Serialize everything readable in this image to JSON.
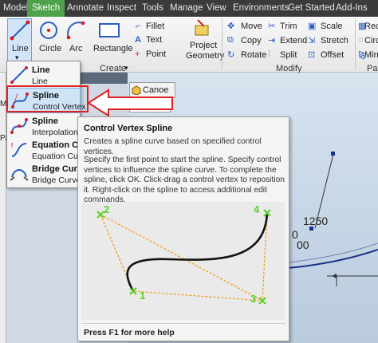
{
  "ribbon_tabs": [
    "Model",
    "Sketch",
    "Annotate",
    "Inspect",
    "Tools",
    "Manage",
    "View",
    "Environments",
    "Get Started",
    "Add-Ins"
  ],
  "active_tab": "Sketch",
  "create_panel": {
    "title": "Create",
    "line": "Line",
    "circle": "Circle",
    "arc": "Arc",
    "rectangle": "Rectangle",
    "fillet": "Fillet",
    "text": "Text",
    "point": "Point",
    "project_geometry_1": "Project",
    "project_geometry_2": "Geometry"
  },
  "modify_panel": {
    "title": "Modify",
    "move": "Move",
    "copy": "Copy",
    "rotate": "Rotate",
    "trim": "Trim",
    "extend": "Extend",
    "split": "Split",
    "scale": "Scale",
    "stretch": "Stretch",
    "offset": "Offset"
  },
  "pattern_panel": {
    "title": "Patt",
    "rect": "Recti",
    "circ": "Circ",
    "mirror": "Mirro"
  },
  "browser": {
    "label_ma": "Ma",
    "label_pa": "Pa"
  },
  "document_tab": "Canoe",
  "dropdown": [
    {
      "title": "Line",
      "subtitle": "Line"
    },
    {
      "title": "Spline",
      "subtitle": "Control Vertex"
    },
    {
      "title": "Spline",
      "subtitle": "Interpolation"
    },
    {
      "title": "Equation Curve",
      "subtitle": "Equation Curve"
    },
    {
      "title": "Bridge Curve",
      "subtitle": "Bridge Curve"
    }
  ],
  "tooltip": {
    "title": "Control Vertex Spline",
    "line1": "Creates a spline curve based on specified control vertices.",
    "line2": "Specify the first point to start the spline. Specify control vertices to influence the spline curve. To complete the spline, click OK. Click-drag a control vertex to reposition it. Right-click on the spline to access additional edit commands.",
    "labels": [
      "1",
      "2",
      "3",
      "4"
    ],
    "footer": "Press F1 for more help"
  },
  "canvas": {
    "dim1": "1250",
    "dim2": "00",
    "dim3": "0"
  },
  "colors": {
    "active_tab": "#4ea24a",
    "highlight": "#e02020",
    "control_point": "#5bd02a",
    "control_line": "#f0a020"
  }
}
